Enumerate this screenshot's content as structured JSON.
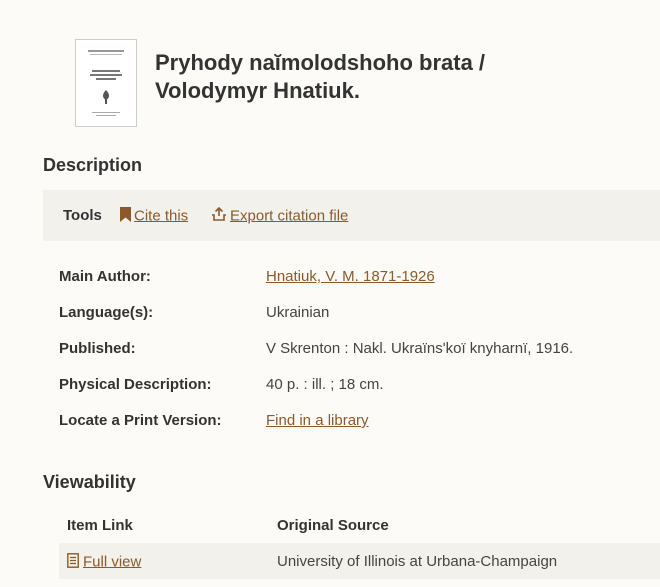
{
  "record": {
    "title_line1": "Pryhody naĭmolodshoho brata /",
    "title_line2": "Volodymyr Hnatiuk.",
    "thumbnail": "book-cover-thumbnail"
  },
  "description": {
    "heading": "Description",
    "tools": {
      "label": "Tools",
      "cite": "Cite this",
      "export": "Export citation file"
    },
    "fields": {
      "main_author_label": "Main Author:",
      "main_author_value": "Hnatiuk, V. M. 1871-1926",
      "language_label": "Language(s):",
      "language_value": "Ukrainian",
      "published_label": "Published:",
      "published_value": "V Skrenton : Nakl. Ukraïnsʹkoï knyharnï, 1916.",
      "physical_label": "Physical Description:",
      "physical_value": "40 p. : ill. ; 18 cm.",
      "locate_label": "Locate a Print Version:",
      "locate_value": "Find in a library"
    }
  },
  "viewability": {
    "heading": "Viewability",
    "columns": [
      "Item Link",
      "Original Source"
    ],
    "rows": [
      {
        "link": "Full view",
        "source": "University of Illinois at Urbana-Champaign"
      }
    ]
  },
  "colors": {
    "link": "#8a5a2b",
    "panel": "#f2f1ec",
    "page": "#fcfbf7"
  }
}
